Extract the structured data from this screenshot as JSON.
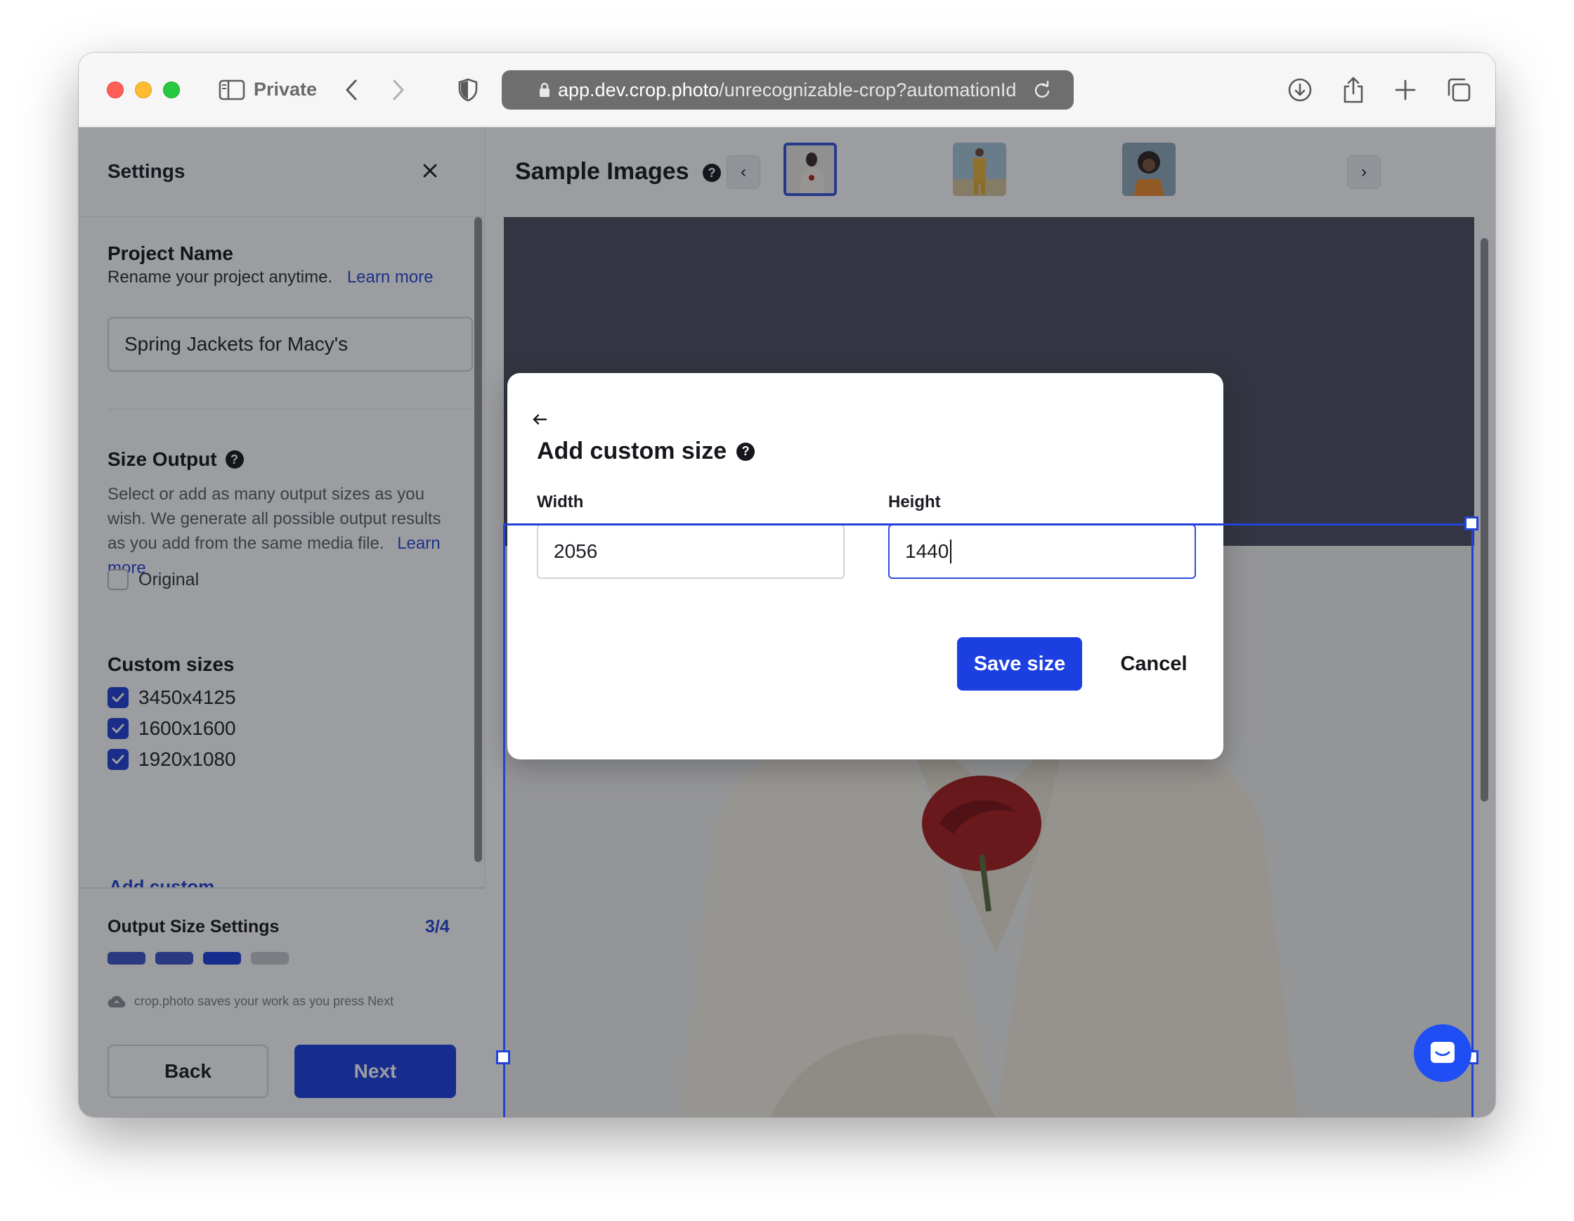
{
  "browser": {
    "private_label": "Private",
    "url_host": "app.dev.crop.photo",
    "url_path": "/unrecognizable-crop?automationId"
  },
  "sidebar": {
    "title": "Settings",
    "project": {
      "title": "Project Name",
      "description": "Rename your project anytime.",
      "learn_more": "Learn more",
      "value": "Spring Jackets for Macy's"
    },
    "size_output": {
      "title": "Size Output",
      "description": "Select or add as many output sizes as you wish. We generate all possible output results as you add from the same media file.",
      "learn_more": "Learn more",
      "original_label": "Original",
      "original_checked": false
    },
    "custom_sizes": {
      "title": "Custom sizes",
      "items": [
        {
          "label": "3450x4125",
          "checked": true
        },
        {
          "label": "1600x1600",
          "checked": true
        },
        {
          "label": "1920x1080",
          "checked": true
        }
      ],
      "add_custom": "Add custom"
    },
    "footer": {
      "title": "Output Size Settings",
      "step": "3/4",
      "progress_current": 3,
      "progress_total": 4,
      "save_note": "crop.photo saves your work as you press Next",
      "back_label": "Back",
      "next_label": "Next"
    }
  },
  "main": {
    "title": "Sample Images",
    "prev_label": "‹",
    "next_label": "›"
  },
  "modal": {
    "title": "Add custom size",
    "width_label": "Width",
    "width_value": "2056",
    "height_label": "Height",
    "height_value": "1440",
    "save_label": "Save size",
    "cancel_label": "Cancel"
  },
  "colors": {
    "accent": "#1b3fe0",
    "link": "#2548d6",
    "progress_done": "#3a55c8",
    "progress_active": "#1b3fe0",
    "progress_todo": "#c8c9ce"
  }
}
